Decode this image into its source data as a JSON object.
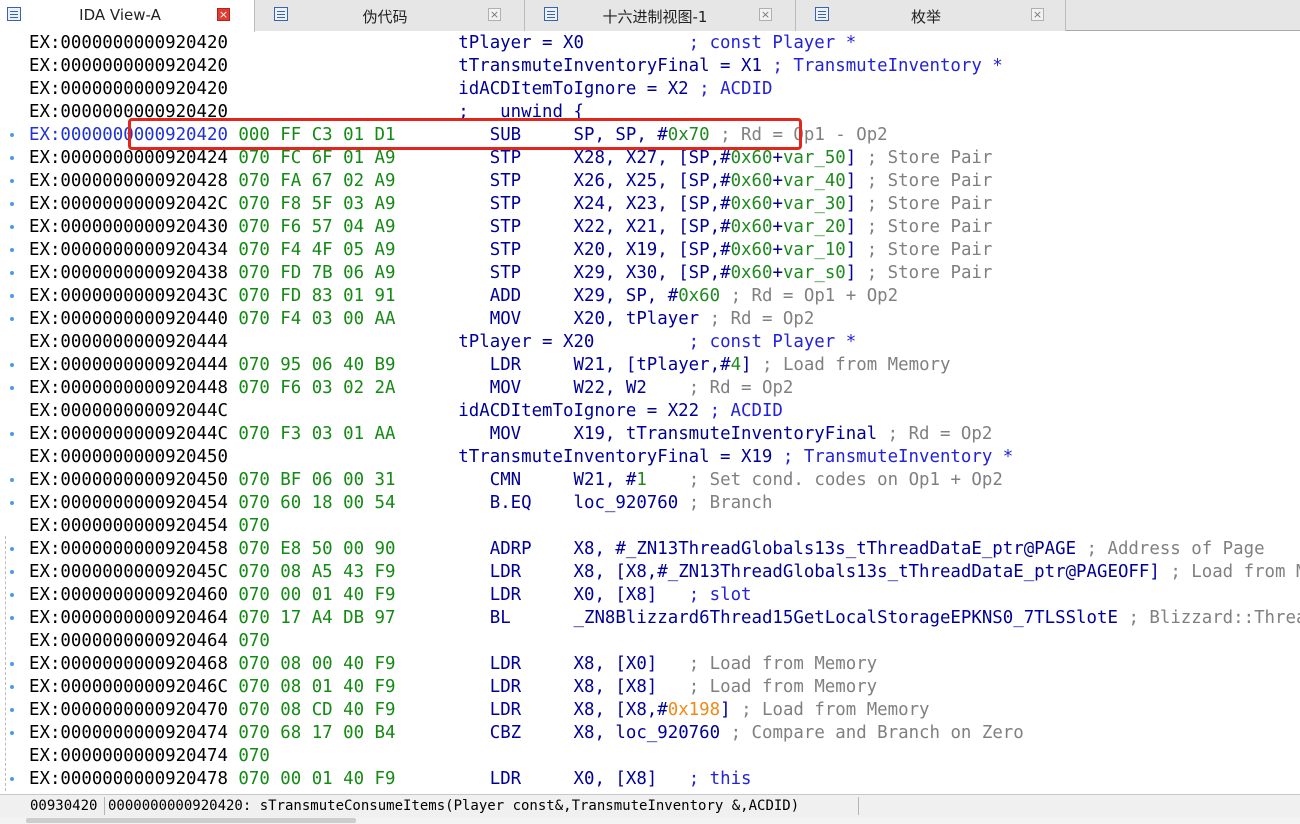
{
  "tabs": [
    {
      "label": "IDA View-A",
      "active": true,
      "icon": "listing-icon"
    },
    {
      "label": "伪代码",
      "active": false,
      "icon": "pseudocode-icon"
    },
    {
      "label": "十六进制视图-1",
      "active": false,
      "icon": "hex-view-icon"
    },
    {
      "label": "枚举",
      "active": false,
      "icon": "enum-icon"
    }
  ],
  "tab_close_symbol": "×",
  "colors": {
    "highlight_box": "#e3261b",
    "address": "#000000",
    "bytes": "#138a13",
    "mnemonic": "#000096",
    "comment": "#808080",
    "breakpoint_dot": "#4d9be6"
  },
  "code": [
    {
      "addr": "EX:0000000000920420",
      "bytes": "",
      "text": "tPlayer = X0",
      "kind": "assign",
      "comment": "; const Player *",
      "comment_style": "blue",
      "dot": false
    },
    {
      "addr": "EX:0000000000920420",
      "bytes": "",
      "text": "tTransmuteInventoryFinal = X1",
      "kind": "assign",
      "comment": "; TransmuteInventory *",
      "comment_style": "blue",
      "dot": false
    },
    {
      "addr": "EX:0000000000920420",
      "bytes": "",
      "text": "idACDItemToIgnore = X2",
      "kind": "assign",
      "comment": "; ACDID",
      "comment_style": "blue",
      "dot": false
    },
    {
      "addr": "EX:0000000000920420",
      "bytes": "",
      "text": ";   unwind {",
      "kind": "directive",
      "comment": "",
      "comment_style": "",
      "dot": false
    },
    {
      "addr": "EX:0000000000920420",
      "bytes": "000 FF C3 01 D1",
      "mnem": "SUB",
      "ops": [
        {
          "t": "SP, SP, #"
        },
        {
          "t": "0x70",
          "c": "num"
        }
      ],
      "comment": "; Rd = Op1 - Op2",
      "comment_style": "gray",
      "dot": true,
      "current": true
    },
    {
      "addr": "EX:0000000000920424",
      "bytes": "070 FC 6F 01 A9",
      "mnem": "STP",
      "ops": [
        {
          "t": "X28, X27, [SP,#"
        },
        {
          "t": "0x60",
          "c": "num"
        },
        {
          "t": "+"
        },
        {
          "t": "var_50",
          "c": "num"
        },
        {
          "t": "]"
        }
      ],
      "comment": "; Store Pair",
      "comment_style": "gray",
      "dot": true
    },
    {
      "addr": "EX:0000000000920428",
      "bytes": "070 FA 67 02 A9",
      "mnem": "STP",
      "ops": [
        {
          "t": "X26, X25, [SP,#"
        },
        {
          "t": "0x60",
          "c": "num"
        },
        {
          "t": "+"
        },
        {
          "t": "var_40",
          "c": "num"
        },
        {
          "t": "]"
        }
      ],
      "comment": "; Store Pair",
      "comment_style": "gray",
      "dot": true
    },
    {
      "addr": "EX:000000000092042C",
      "bytes": "070 F8 5F 03 A9",
      "mnem": "STP",
      "ops": [
        {
          "t": "X24, X23, [SP,#"
        },
        {
          "t": "0x60",
          "c": "num"
        },
        {
          "t": "+"
        },
        {
          "t": "var_30",
          "c": "num"
        },
        {
          "t": "]"
        }
      ],
      "comment": "; Store Pair",
      "comment_style": "gray",
      "dot": true
    },
    {
      "addr": "EX:0000000000920430",
      "bytes": "070 F6 57 04 A9",
      "mnem": "STP",
      "ops": [
        {
          "t": "X22, X21, [SP,#"
        },
        {
          "t": "0x60",
          "c": "num"
        },
        {
          "t": "+"
        },
        {
          "t": "var_20",
          "c": "num"
        },
        {
          "t": "]"
        }
      ],
      "comment": "; Store Pair",
      "comment_style": "gray",
      "dot": true
    },
    {
      "addr": "EX:0000000000920434",
      "bytes": "070 F4 4F 05 A9",
      "mnem": "STP",
      "ops": [
        {
          "t": "X20, X19, [SP,#"
        },
        {
          "t": "0x60",
          "c": "num"
        },
        {
          "t": "+"
        },
        {
          "t": "var_10",
          "c": "num"
        },
        {
          "t": "]"
        }
      ],
      "comment": "; Store Pair",
      "comment_style": "gray",
      "dot": true
    },
    {
      "addr": "EX:0000000000920438",
      "bytes": "070 FD 7B 06 A9",
      "mnem": "STP",
      "ops": [
        {
          "t": "X29, X30, [SP,#"
        },
        {
          "t": "0x60",
          "c": "num"
        },
        {
          "t": "+"
        },
        {
          "t": "var_s0",
          "c": "num"
        },
        {
          "t": "]"
        }
      ],
      "comment": "; Store Pair",
      "comment_style": "gray",
      "dot": true
    },
    {
      "addr": "EX:000000000092043C",
      "bytes": "070 FD 83 01 91",
      "mnem": "ADD",
      "ops": [
        {
          "t": "X29, SP, #"
        },
        {
          "t": "0x60",
          "c": "num"
        }
      ],
      "comment": "; Rd = Op1 + Op2",
      "comment_style": "gray",
      "dot": true
    },
    {
      "addr": "EX:0000000000920440",
      "bytes": "070 F4 03 00 AA",
      "mnem": "MOV",
      "ops": [
        {
          "t": "X20, tPlayer"
        }
      ],
      "comment": "; Rd = Op2",
      "comment_style": "gray",
      "dot": true
    },
    {
      "addr": "EX:0000000000920444",
      "bytes": "",
      "text": "tPlayer = X20",
      "kind": "assign",
      "comment": "; const Player *",
      "comment_style": "blue",
      "dot": false
    },
    {
      "addr": "EX:0000000000920444",
      "bytes": "070 95 06 40 B9",
      "mnem": "LDR",
      "ops": [
        {
          "t": "W21, [tPlayer,#"
        },
        {
          "t": "4",
          "c": "num"
        },
        {
          "t": "]"
        }
      ],
      "comment": "; Load from Memory",
      "comment_style": "gray",
      "dot": true
    },
    {
      "addr": "EX:0000000000920448",
      "bytes": "070 F6 03 02 2A",
      "mnem": "MOV",
      "ops": [
        {
          "t": "W22, W2"
        }
      ],
      "comment": "; Rd = Op2",
      "comment_style": "gray",
      "dot": true
    },
    {
      "addr": "EX:000000000092044C",
      "bytes": "",
      "text": "idACDItemToIgnore = X22",
      "kind": "assign",
      "comment": "; ACDID",
      "comment_style": "blue",
      "dot": false
    },
    {
      "addr": "EX:000000000092044C",
      "bytes": "070 F3 03 01 AA",
      "mnem": "MOV",
      "ops": [
        {
          "t": "X19, tTransmuteInventoryFinal"
        }
      ],
      "comment": "; Rd = Op2",
      "comment_style": "gray",
      "dot": true,
      "comment_gap": 1
    },
    {
      "addr": "EX:0000000000920450",
      "bytes": "",
      "text": "tTransmuteInventoryFinal = X19",
      "kind": "assign",
      "comment": "; TransmuteInventory *",
      "comment_style": "blue",
      "dot": false
    },
    {
      "addr": "EX:0000000000920450",
      "bytes": "070 BF 06 00 31",
      "mnem": "CMN",
      "ops": [
        {
          "t": "W21, #"
        },
        {
          "t": "1",
          "c": "num"
        }
      ],
      "comment": "; Set cond. codes on Op1 + Op2",
      "comment_style": "gray",
      "dot": true
    },
    {
      "addr": "EX:0000000000920454",
      "bytes": "070 60 18 00 54",
      "mnem": "B.EQ",
      "ops": [
        {
          "t": "loc_920760"
        }
      ],
      "comment": "; Branch",
      "comment_style": "gray",
      "dot": true
    },
    {
      "addr": "EX:0000000000920454",
      "bytes": "070",
      "mnem": "",
      "ops": [],
      "comment": "",
      "comment_style": "",
      "dot": false
    },
    {
      "addr": "EX:0000000000920458",
      "bytes": "070 E8 50 00 90",
      "mnem": "ADRP",
      "ops": [
        {
          "t": "X8, #_ZN13ThreadGlobals13s_tThreadDataE_ptr@PAGE"
        }
      ],
      "comment": "; Address of Page",
      "comment_style": "gray",
      "dot": true,
      "comment_gap": 1
    },
    {
      "addr": "EX:000000000092045C",
      "bytes": "070 08 A5 43 F9",
      "mnem": "LDR",
      "ops": [
        {
          "t": "X8, [X8,#_ZN13ThreadGlobals13s_tThreadDataE_ptr@PAGEOFF]"
        }
      ],
      "comment": "; Load from Memory",
      "comment_style": "gray",
      "dot": true,
      "comment_gap": 1
    },
    {
      "addr": "EX:0000000000920460",
      "bytes": "070 00 01 40 F9",
      "mnem": "LDR",
      "ops": [
        {
          "t": "X0, [X8]"
        }
      ],
      "comment": "; slot",
      "comment_style": "blue",
      "dot": true
    },
    {
      "addr": "EX:0000000000920464",
      "bytes": "070 17 A4 DB 97",
      "mnem": "BL",
      "ops": [
        {
          "t": "_ZN8Blizzard6Thread15GetLocalStorageEPKNS0_7TLSSlotE",
          "c": "sym"
        }
      ],
      "comment": "; Blizzard::Thread::GetLocalStorage",
      "comment_style": "gray",
      "dot": true,
      "comment_gap": 1
    },
    {
      "addr": "EX:0000000000920464",
      "bytes": "070",
      "mnem": "",
      "ops": [],
      "comment": "",
      "comment_style": "",
      "dot": false
    },
    {
      "addr": "EX:0000000000920468",
      "bytes": "070 08 00 40 F9",
      "mnem": "LDR",
      "ops": [
        {
          "t": "X8, [X0]"
        }
      ],
      "comment": "; Load from Memory",
      "comment_style": "gray",
      "dot": true
    },
    {
      "addr": "EX:000000000092046C",
      "bytes": "070 08 01 40 F9",
      "mnem": "LDR",
      "ops": [
        {
          "t": "X8, [X8]"
        }
      ],
      "comment": "; Load from Memory",
      "comment_style": "gray",
      "dot": true
    },
    {
      "addr": "EX:0000000000920470",
      "bytes": "070 08 CD 40 F9",
      "mnem": "LDR",
      "ops": [
        {
          "t": "X8, [X8,#"
        },
        {
          "t": "0x198",
          "c": "orange"
        },
        {
          "t": "]"
        }
      ],
      "comment": "; Load from Memory",
      "comment_style": "gray",
      "dot": true
    },
    {
      "addr": "EX:0000000000920474",
      "bytes": "070 68 17 00 B4",
      "mnem": "CBZ",
      "ops": [
        {
          "t": "X8, loc_920760"
        }
      ],
      "comment": "; Compare and Branch on Zero",
      "comment_style": "gray",
      "dot": true
    },
    {
      "addr": "EX:0000000000920474",
      "bytes": "070",
      "mnem": "",
      "ops": [],
      "comment": "",
      "comment_style": "",
      "dot": false
    },
    {
      "addr": "EX:0000000000920478",
      "bytes": "070 00 01 40 F9",
      "mnem": "LDR",
      "ops": [
        {
          "t": "X0, [X8]"
        }
      ],
      "comment": "; this",
      "comment_style": "blue",
      "dot": true
    }
  ],
  "status": {
    "offset": "00930420",
    "location": "0000000000920420: sTransmuteConsumeItems(Player const&,TransmuteInventory &,ACDID)"
  }
}
